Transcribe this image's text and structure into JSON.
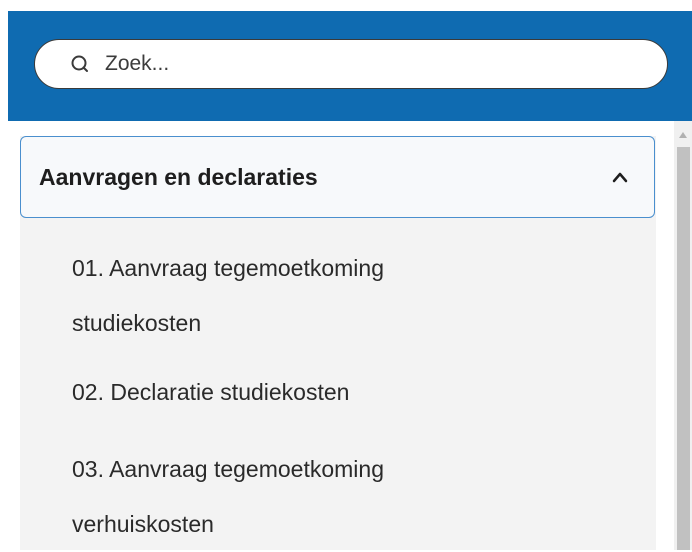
{
  "search": {
    "placeholder": "Zoek..."
  },
  "accordion": {
    "title": "Aanvragen en declaraties",
    "expanded": true,
    "items": [
      {
        "line1": "01. Aanvraag tegemoetkoming",
        "line2": "studiekosten"
      },
      {
        "line1": "02. Declaratie studiekosten"
      },
      {
        "line1": "03. Aanvraag tegemoetkoming",
        "line2": "verhuiskosten"
      }
    ]
  },
  "colors": {
    "header_bg": "#0f6bb1",
    "accordion_border": "#4a8fce",
    "panel_bg": "#f3f3f3"
  },
  "icons": {
    "search": "search-icon",
    "chevron": "chevron-up-icon",
    "scroll_up": "scroll-up-arrow-icon"
  }
}
